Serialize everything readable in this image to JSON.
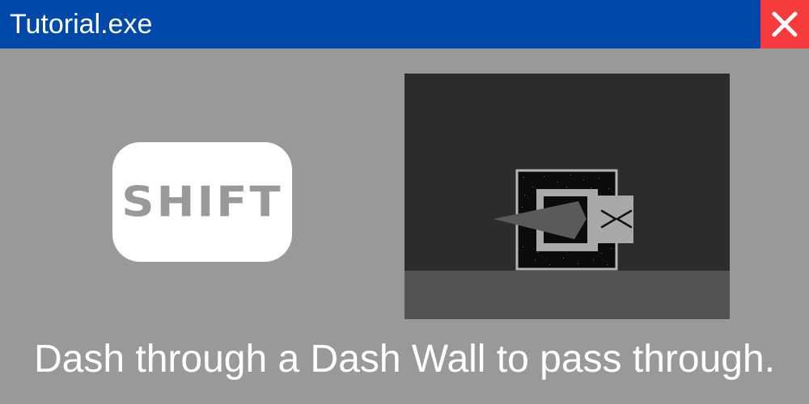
{
  "window": {
    "title": "Tutorial.exe",
    "close_icon": "close-icon"
  },
  "tutorial": {
    "key_label": "SHIFT",
    "caption": "Dash through a Dash Wall to pass through."
  },
  "scene": {
    "player_icon": "player-arrow-icon",
    "wall_icon": "dash-wall-icon",
    "face_icon": "squint-face-icon"
  },
  "colors": {
    "titlebar": "#0148ab",
    "close_button": "#f53b3b",
    "body_background": "#999999",
    "key_background": "#ffffff",
    "key_text": "#999999",
    "scene_background": "#2c2c2c",
    "scene_floor": "#535353",
    "caption_text": "#ffffff"
  }
}
